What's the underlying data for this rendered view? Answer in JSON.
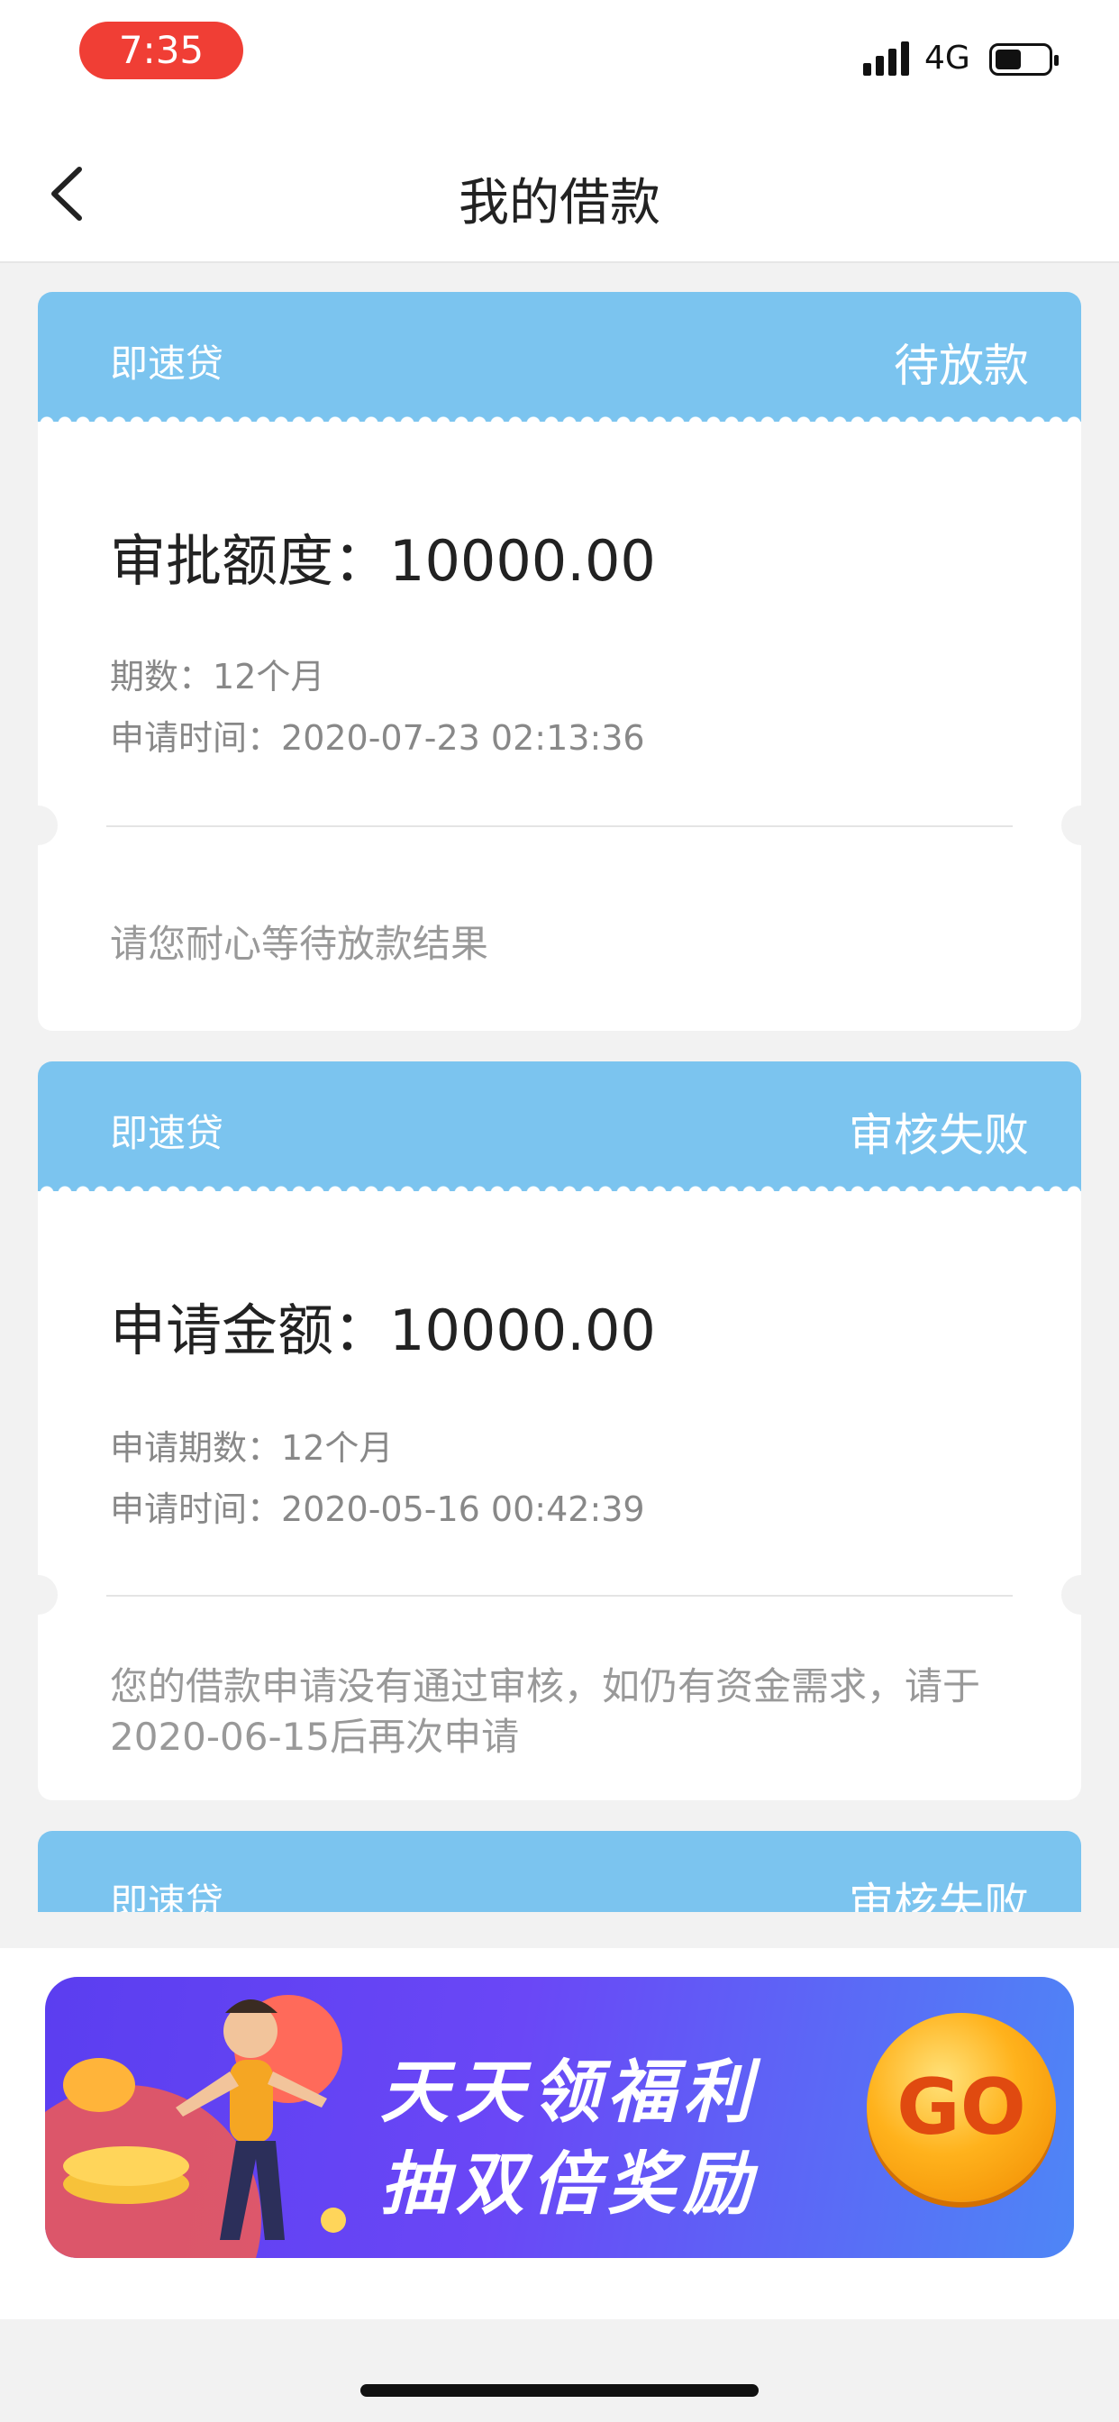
{
  "status_bar": {
    "time": "7:35",
    "network": "4G"
  },
  "nav": {
    "title": "我的借款"
  },
  "loans": [
    {
      "product": "即速贷",
      "status": "待放款",
      "amount_label": "审批额度：",
      "amount": "10000.00",
      "term_label": "期数：",
      "term": "12个月",
      "time_label": "申请时间：",
      "time": "2020-07-23 02:13:36",
      "message": "请您耐心等待放款结果"
    },
    {
      "product": "即速贷",
      "status": "审核失败",
      "amount_label": "申请金额：",
      "amount": "10000.00",
      "term_label": "申请期数：",
      "term": "12个月",
      "time_label": "申请时间：",
      "time": "2020-05-16 00:42:39",
      "message": "您的借款申请没有通过审核，如仍有资金需求，请于2020-06-15后再次申请"
    },
    {
      "product": "即速贷",
      "status": "审核失败"
    }
  ],
  "banner": {
    "line1": "天天领福利",
    "line2": "抽双倍奖励",
    "go": "GO"
  },
  "colors": {
    "card_header": "#7bc4ef",
    "time_pill": "#f03e35",
    "banner": "#6a47f6"
  }
}
